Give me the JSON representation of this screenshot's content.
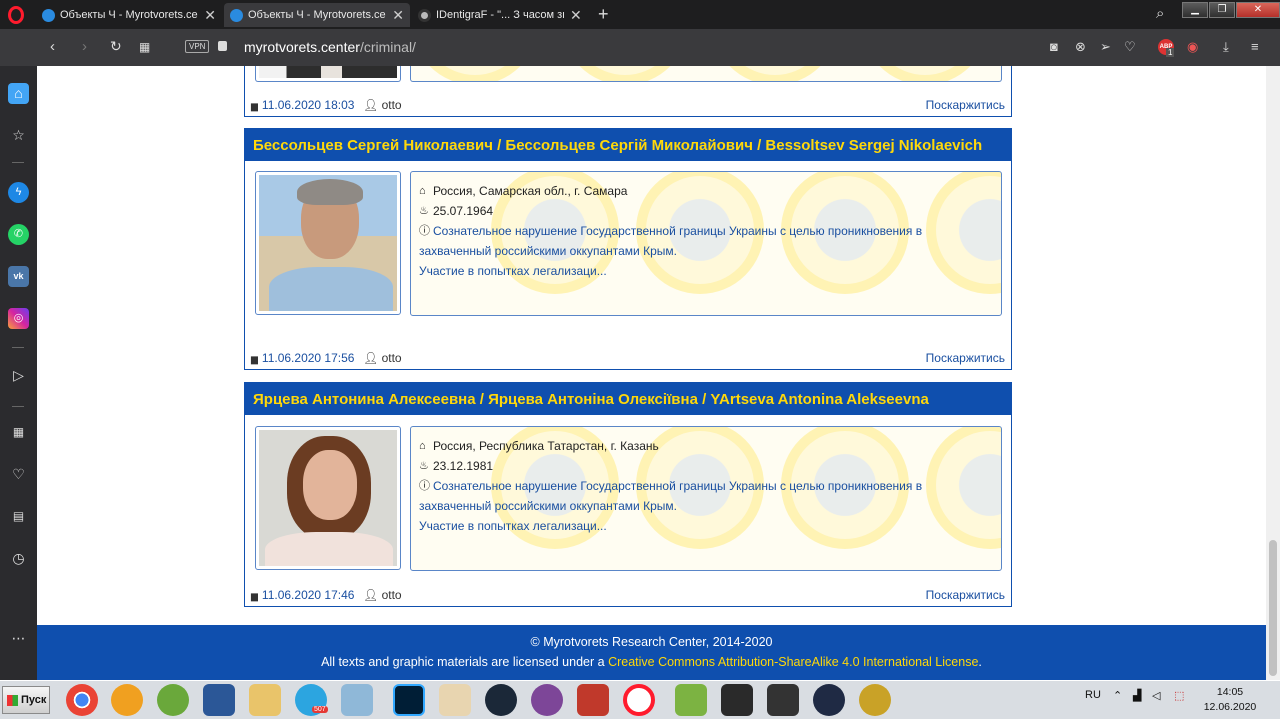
{
  "browser": {
    "tabs": [
      {
        "title": "Объекты Ч - Myrotvorets.cen",
        "active": false
      },
      {
        "title": "Объекты Ч - Myrotvorets.cen",
        "active": true
      },
      {
        "title": "IDentigraF - \"... З часом знай",
        "active": false
      }
    ],
    "new_tab": "+",
    "url_host": "myrotvorets.center",
    "url_path": "/criminal/",
    "vpn_label": "VPN",
    "adblock_label": "ABP",
    "adblock_count": "1"
  },
  "page": {
    "top_card_footer": {
      "date": "11.06.2020 18:03",
      "user": "otto",
      "complain": "Поскаржитись"
    },
    "cards": [
      {
        "title": "Бессольцев Сергей Николаевич / Бессольцев Сергій Миколайович / Bessoltsev Sergej Nikolaevich",
        "location": "Россия, Самарская обл., г. Самара",
        "birth_date": "25.07.1964",
        "reason_line1": "Сознательное нарушение Государственной границы Украины с целью проникновения в",
        "reason_line2": "захваченный российскими оккупантами Крым.",
        "reason_line3": "Участие в попытках легализаци...",
        "date": "11.06.2020 17:56",
        "user": "otto",
        "complain": "Поскаржитись"
      },
      {
        "title": "Ярцева Антонина Алексеевна / Ярцева Антоніна Олексіївна / YArtseva Antonina Alekseevna",
        "location": "Россия, Республика Татарстан, г. Казань",
        "birth_date": "23.12.1981",
        "reason_line1": "Сознательное нарушение Государственной границы Украины с целью проникновения в",
        "reason_line2": "захваченный российскими оккупантами Крым.",
        "reason_line3": "Участие в попытках легализаци...",
        "date": "11.06.2020 17:46",
        "user": "otto",
        "complain": "Поскаржитись"
      }
    ],
    "footer": {
      "copyright": "© Myrotvorets Research Center, 2014-2020",
      "license_prefix": "All texts and graphic materials are licensed under a ",
      "license_link": "Creative Commons Attribution-ShareAlike 4.0 International License",
      "license_suffix": "."
    }
  },
  "taskbar": {
    "start_label": "Пуск",
    "telegram_badge": "507",
    "lang": "RU",
    "time": "14:05",
    "date": "12.06.2020"
  },
  "colors": {
    "brand_blue": "#0f4fae",
    "brand_yellow": "#ffd80a",
    "link_blue": "#1a4fa0"
  }
}
